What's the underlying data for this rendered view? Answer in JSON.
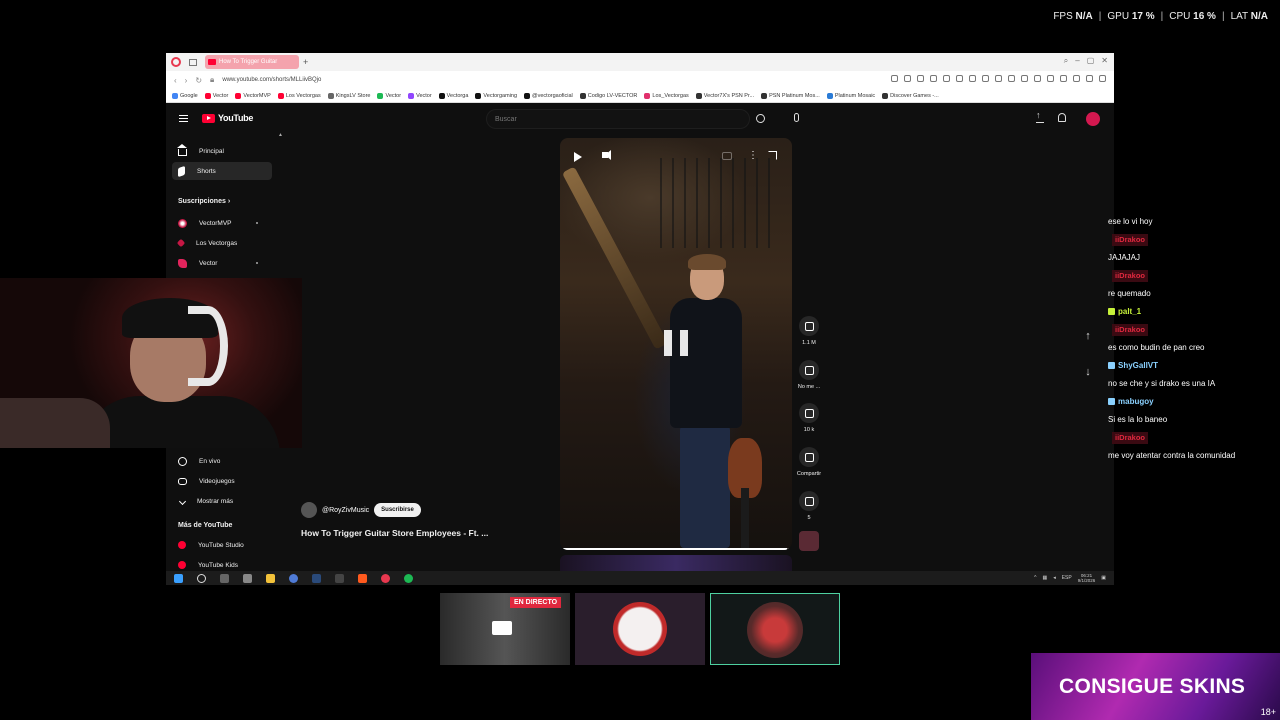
{
  "stats": [
    {
      "label": "FPS",
      "value": "N/A"
    },
    {
      "label": "GPU",
      "value": "17 %"
    },
    {
      "label": "CPU",
      "value": "16 %"
    },
    {
      "label": "LAT",
      "value": "N/A"
    }
  ],
  "browser": {
    "tab_title": "How To Trigger Guitar",
    "new_tab": "+",
    "url": "www.youtube.com/shorts/MLLiivBQjo",
    "bookmarks": [
      {
        "label": "Google",
        "color": "#4285f4"
      },
      {
        "label": "Vector",
        "color": "#ff0033"
      },
      {
        "label": "VectorMVP",
        "color": "#ff0033"
      },
      {
        "label": "Los Vectorgas",
        "color": "#ff0033"
      },
      {
        "label": "KingsLV Store",
        "color": "#666666"
      },
      {
        "label": "Vector",
        "color": "#1db954"
      },
      {
        "label": "Vector",
        "color": "#9146ff"
      },
      {
        "label": "Vectorga",
        "color": "#111111"
      },
      {
        "label": "Vectorgaming",
        "color": "#111111"
      },
      {
        "label": "@vectorgaoficial",
        "color": "#111111"
      },
      {
        "label": "Codigo LV-VECTOR",
        "color": "#333333"
      },
      {
        "label": "Los_Vectorgas",
        "color": "#e1306c"
      },
      {
        "label": "Vector7X's PSN Pr...",
        "color": "#333333"
      },
      {
        "label": "PSN Platinum Mos...",
        "color": "#333333"
      },
      {
        "label": "Platinum Mosaic",
        "color": "#2a7bd6"
      },
      {
        "label": "Discover Games -...",
        "color": "#333333"
      }
    ]
  },
  "youtube": {
    "logo": "YouTube",
    "search_placeholder": "Buscar",
    "sidebar": {
      "items": [
        {
          "label": "Principal"
        },
        {
          "label": "Shorts"
        }
      ],
      "subs_header": "Suscripciones",
      "subs": [
        {
          "label": "VectorMVP"
        },
        {
          "label": "Los Vectorgas"
        },
        {
          "label": "Vector"
        }
      ],
      "explore": [
        {
          "label": "En vivo"
        },
        {
          "label": "Videojuegos"
        },
        {
          "label": "Mostrar más"
        }
      ],
      "more_header": "Más de YouTube",
      "more": [
        {
          "label": "YouTube Studio"
        },
        {
          "label": "YouTube Kids"
        }
      ]
    },
    "short": {
      "channel": "@RoyZivMusic",
      "subscribe": "Suscribirse",
      "title": "How To Trigger Guitar Store Employees - Ft. ...",
      "progress": 0.98
    },
    "actions": [
      {
        "label": "1.1 M"
      },
      {
        "label": "No me ..."
      },
      {
        "label": "10 k"
      },
      {
        "label": "Compartir"
      },
      {
        "label": "5"
      }
    ]
  },
  "taskbar": {
    "tray_lang": "ESP",
    "time": "06:21",
    "date": "9/1/2026"
  },
  "chat": [
    {
      "type": "msg",
      "text": "ese lo vi hoy"
    },
    {
      "type": "user",
      "text": "iiDrakoo",
      "color": "#e0283e"
    },
    {
      "type": "msg",
      "text": "JAJAJAJ"
    },
    {
      "type": "user",
      "text": "iiDrakoo",
      "color": "#e0283e"
    },
    {
      "type": "msg",
      "text": "re quemado"
    },
    {
      "type": "user",
      "text": "palt_1",
      "color": "#c7f23a"
    },
    {
      "type": "user",
      "text": "iiDrakoo",
      "color": "#e0283e"
    },
    {
      "type": "msg",
      "text": "es como budin de pan creo"
    },
    {
      "type": "user",
      "text": "ShyGallVT",
      "color": "#8ad1ff"
    },
    {
      "type": "msg",
      "text": "no se che y si drako es una IA"
    },
    {
      "type": "user",
      "text": "mabugoy",
      "color": "#8ad1ff"
    },
    {
      "type": "msg",
      "text": "Si es la lo baneo"
    },
    {
      "type": "user",
      "text": "iiDrakoo",
      "color": "#e0283e"
    },
    {
      "type": "msg",
      "text": "me voy atentar contra la comunidad"
    }
  ],
  "cams": {
    "live_label": "EN DIRECTO"
  },
  "ad": {
    "text": "CONSIGUE SKINS",
    "age": "18+"
  }
}
